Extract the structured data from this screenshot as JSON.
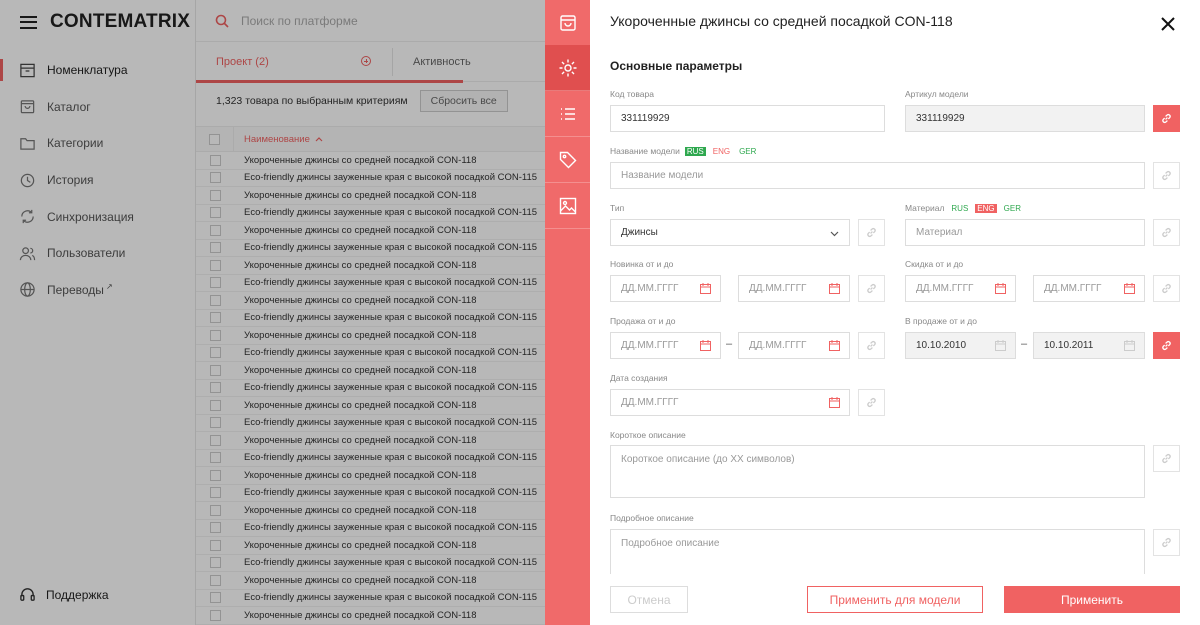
{
  "app": {
    "logo": "CONTEMATRIX",
    "nav": [
      {
        "label": "Номенклатура",
        "icon": "inbox-icon",
        "active": true
      },
      {
        "label": "Каталог",
        "icon": "bag-icon",
        "active": false
      },
      {
        "label": "Категории",
        "icon": "folder-icon",
        "active": false
      },
      {
        "label": "История",
        "icon": "clock-icon",
        "active": false
      },
      {
        "label": "Синхронизация",
        "icon": "sync-icon",
        "active": false
      },
      {
        "label": "Пользователи",
        "icon": "users-icon",
        "active": false
      },
      {
        "label": "Переводы",
        "icon": "globe-icon",
        "active": false
      }
    ],
    "support": "Поддержка",
    "search_placeholder": "Поиск по платформе",
    "tabs": {
      "projects": "Проект (2)",
      "activity": "Активность"
    },
    "filter": {
      "count": "1,323 товара по выбранным критериям",
      "reset": "Сбросить все"
    },
    "table": {
      "header": "Наименование",
      "rows": [
        "Укороченные джинсы со средней посадкой CON-118",
        "Eco-friendly джинсы зауженные края с высокой посадкой CON-115",
        "Укороченные джинсы со средней посадкой CON-118",
        "Eco-friendly джинсы зауженные края с высокой посадкой CON-115",
        "Укороченные джинсы со средней посадкой CON-118",
        "Eco-friendly джинсы зауженные края с высокой посадкой CON-115",
        "Укороченные джинсы со средней посадкой CON-118",
        "Eco-friendly джинсы зауженные края с высокой посадкой CON-115",
        "Укороченные джинсы со средней посадкой CON-118",
        "Eco-friendly джинсы зауженные края с высокой посадкой CON-115",
        "Укороченные джинсы со средней посадкой CON-118",
        "Eco-friendly джинсы зауженные края с высокой посадкой CON-115",
        "Укороченные джинсы со средней посадкой CON-118",
        "Eco-friendly джинсы зауженные края с высокой посадкой CON-115",
        "Укороченные джинсы со средней посадкой CON-118",
        "Eco-friendly джинсы зауженные края с высокой посадкой CON-115",
        "Укороченные джинсы со средней посадкой CON-118",
        "Eco-friendly джинсы зауженные края с высокой посадкой CON-115",
        "Укороченные джинсы со средней посадкой CON-118",
        "Eco-friendly джинсы зауженные края с высокой посадкой CON-115",
        "Укороченные джинсы со средней посадкой CON-118",
        "Eco-friendly джинсы зауженные края с высокой посадкой CON-115",
        "Укороченные джинсы со средней посадкой CON-118",
        "Eco-friendly джинсы зауженные края с высокой посадкой CON-115",
        "Укороченные джинсы со средней посадкой CON-118",
        "Eco-friendly джинсы зауженные края с высокой посадкой CON-115",
        "Укороченные джинсы со средней посадкой CON-118"
      ]
    }
  },
  "rail": [
    "bag-icon",
    "gear-icon",
    "list-icon",
    "tag-icon",
    "image-icon"
  ],
  "panel": {
    "title": "Укороченные джинсы со средней посадкой CON-118",
    "section": "Основные параметры",
    "langs": {
      "rus": "RUS",
      "eng": "ENG",
      "ger": "GER"
    },
    "fields": {
      "code_label": "Код товара",
      "code_value": "331119929",
      "article_label": "Артикул модели",
      "article_value": "331119929",
      "model_name_label": "Название модели",
      "model_name_placeholder": "Название модели",
      "type_label": "Тип",
      "type_value": "Джинсы",
      "material_label": "Материал",
      "material_placeholder": "Материал",
      "new_label": "Новинка от и до",
      "discount_label": "Скидка от и до",
      "sale_label": "Продажа от и до",
      "onsale_label": "В продаже от и до",
      "onsale_from": "10.10.2010",
      "onsale_to": "10.10.2011",
      "created_label": "Дата создания",
      "date_placeholder": "ДД.ММ.ГГГГ",
      "dash": "–",
      "short_label": "Короткое описание",
      "short_placeholder": "Короткое описание (до XX символов)",
      "long_label": "Подробное описание",
      "long_placeholder": "Подробное описание"
    },
    "buttons": {
      "cancel": "Отмена",
      "apply_model": "Применить для модели",
      "apply": "Применить"
    },
    "colors": {
      "accent": "#f06262",
      "rail": "#f06a6a",
      "lang_green": "#2fa84f"
    }
  }
}
